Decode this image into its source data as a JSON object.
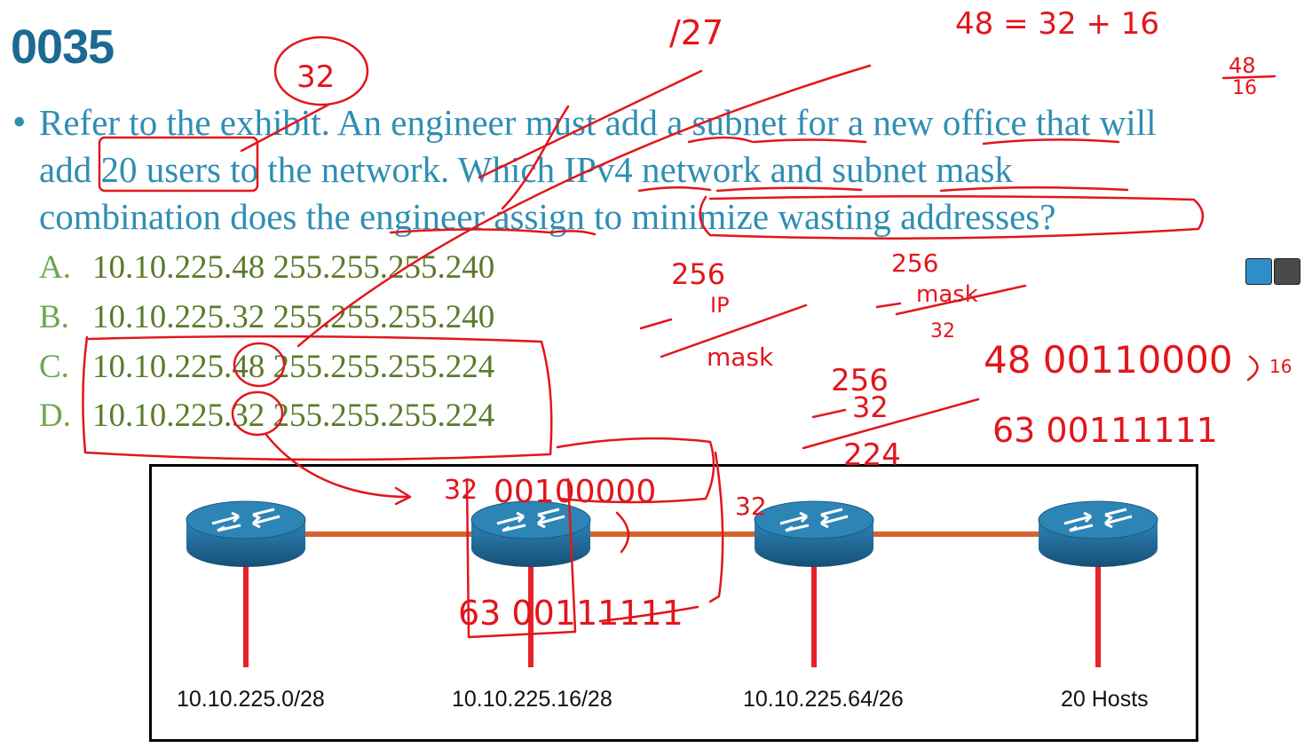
{
  "slide": {
    "title": "0035",
    "bullet": "•",
    "question_lines": [
      "Refer to the exhibit. An engineer must add a subnet for a new office that will",
      "add 20 users to the network. Which IPv4 network and subnet mask",
      "combination does the engineer assign to minimize wasting addresses?"
    ],
    "options": [
      {
        "letter": "A.",
        "text": "10.10.225.48 255.255.255.240"
      },
      {
        "letter": "B.",
        "text": "10.10.225.32 255.255.255.240"
      },
      {
        "letter": "C.",
        "text": "10.10.225.48 255.255.255.224"
      },
      {
        "letter": "D.",
        "text": "10.10.225.32 255.255.255.224"
      }
    ]
  },
  "exhibit": {
    "labels": [
      "10.10.225.0/28",
      "10.10.225.16/28",
      "10.10.225.64/26",
      "20 Hosts"
    ],
    "router_icon": "router-icon",
    "link_color": "#d2642e",
    "drop_color": "#e8202a",
    "router_color": "#1f6d9a"
  },
  "annotations": {
    "n127": "/27",
    "eq": "48 = 32 + 16",
    "c32": "32",
    "n48": "48",
    "n16s": "16",
    "n256a": "256",
    "ip": "IP",
    "mask": "mask",
    "n256b": "256",
    "mark": "mask",
    "n32b": "32",
    "n256c": "256",
    "n32c": "32",
    "n224": "224",
    "bin48": "48 00110000",
    "n16": "16",
    "bin63": "63 00111111",
    "left32": "32",
    "top_bits": "00100000",
    "bits63": "63 00111111",
    "r3_32": "32"
  },
  "colors": {
    "ink": "#e2161c",
    "title": "#1b6a93",
    "question": "#2f8eb4",
    "options": "#6aa84f"
  }
}
